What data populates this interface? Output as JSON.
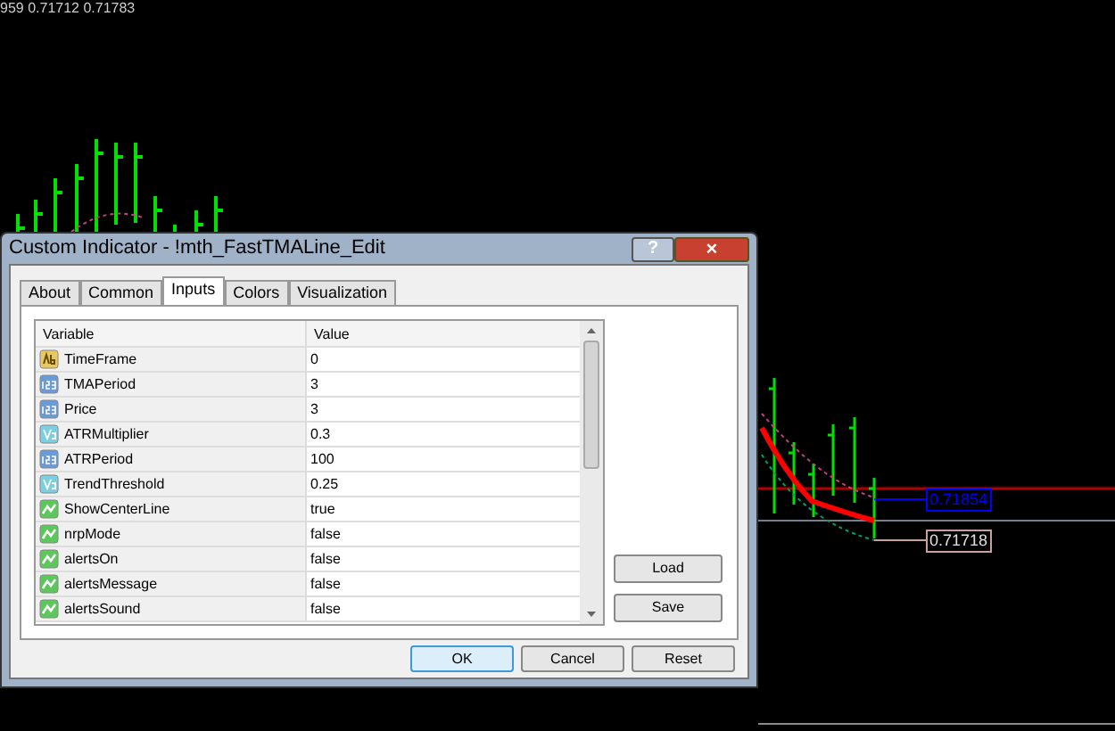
{
  "chart": {
    "header": "959 0.71712 0.71783",
    "price_labels": [
      {
        "text": "0.71854",
        "color": "#0000ff"
      },
      {
        "text": "0.71718",
        "color": "#c8a0a0"
      }
    ]
  },
  "dialog": {
    "title": "Custom Indicator - !mth_FastTMALine_Edit",
    "help": "?",
    "close": "×",
    "tabs": [
      {
        "label": "About",
        "selected": false
      },
      {
        "label": "Common",
        "selected": false
      },
      {
        "label": "Inputs",
        "selected": true
      },
      {
        "label": "Colors",
        "selected": false
      },
      {
        "label": "Visualization",
        "selected": false
      }
    ],
    "table": {
      "columns": [
        "Variable",
        "Value"
      ],
      "rows": [
        {
          "kind": "string",
          "variable": "TimeFrame",
          "value": "0"
        },
        {
          "kind": "integer",
          "variable": "TMAPeriod",
          "value": "3"
        },
        {
          "kind": "integer",
          "variable": "Price",
          "value": "3"
        },
        {
          "kind": "double",
          "variable": "ATRMultiplier",
          "value": "0.3"
        },
        {
          "kind": "integer",
          "variable": "ATRPeriod",
          "value": "100"
        },
        {
          "kind": "double",
          "variable": "TrendThreshold",
          "value": "0.25"
        },
        {
          "kind": "bool",
          "variable": "ShowCenterLine",
          "value": "true"
        },
        {
          "kind": "bool",
          "variable": "nrpMode",
          "value": "false"
        },
        {
          "kind": "bool",
          "variable": "alertsOn",
          "value": "false"
        },
        {
          "kind": "bool",
          "variable": "alertsMessage",
          "value": "false"
        },
        {
          "kind": "bool",
          "variable": "alertsSound",
          "value": "false"
        }
      ]
    },
    "side_buttons": [
      "Load",
      "Save"
    ],
    "buttons": [
      {
        "label": "OK",
        "default": true
      },
      {
        "label": "Cancel",
        "default": false
      },
      {
        "label": "Reset",
        "default": false
      }
    ]
  }
}
